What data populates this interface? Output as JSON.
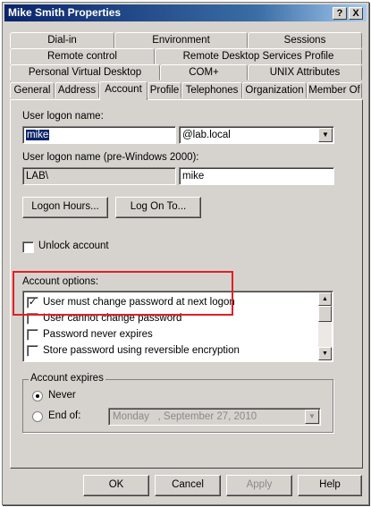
{
  "window": {
    "title": "Mike Smith Properties",
    "help_glyph": "?",
    "close_glyph": "X"
  },
  "tabs": {
    "row1": [
      "Dial-in",
      "Environment",
      "Sessions"
    ],
    "row2": [
      "Remote control",
      "Remote Desktop Services Profile"
    ],
    "row3": [
      "Personal Virtual Desktop",
      "COM+",
      "UNIX Attributes"
    ],
    "row4": [
      "General",
      "Address",
      "Account",
      "Profile",
      "Telephones",
      "Organization",
      "Member Of"
    ],
    "active": "Account"
  },
  "account": {
    "logon_name_label": "User logon name:",
    "logon_name_value": "mike",
    "domain_value": "@lab.local",
    "pre2000_label": "User logon name (pre-Windows 2000):",
    "pre2000_domain": "LAB\\",
    "pre2000_name": "mike",
    "logon_hours_button": "Logon Hours...",
    "logon_to_button": "Log On To...",
    "unlock_label": "Unlock account",
    "options_label": "Account options:",
    "options": [
      {
        "label": "User must change password at next logon",
        "checked": true
      },
      {
        "label": "User cannot change password",
        "checked": false
      },
      {
        "label": "Password never expires",
        "checked": false
      },
      {
        "label": "Store password using reversible encryption",
        "checked": false
      }
    ],
    "expires_label": "Account expires",
    "never_label": "Never",
    "end_of_label": "End of:",
    "expires_selected": "Never",
    "end_date_day": "Monday",
    "end_date_rest": ", September 27, 2010"
  },
  "footer": {
    "ok": "OK",
    "cancel": "Cancel",
    "apply": "Apply",
    "help": "Help"
  },
  "colors": {
    "highlight": "#e01f26",
    "title_bar": "#0a246a",
    "selection": "#0a246a"
  },
  "icons": {
    "combo": "chevron-down-icon",
    "check": "checkmark-icon",
    "scroll_up": "scroll-up-icon",
    "scroll_down": "scroll-down-icon"
  }
}
